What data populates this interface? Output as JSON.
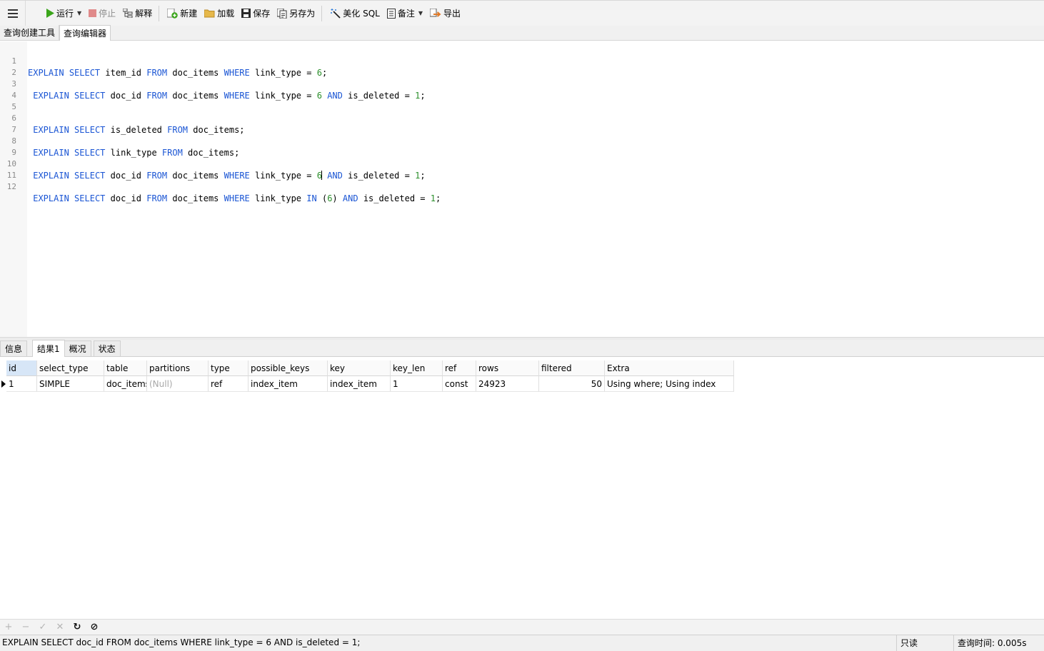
{
  "toolbar": {
    "menu_icon": "hamburger-icon",
    "run": "运行",
    "stop": "停止",
    "explain": "解释",
    "new": "新建",
    "load": "加载",
    "save": "保存",
    "save_as": "另存为",
    "beautify": "美化 SQL",
    "comment": "备注",
    "export": "导出",
    "colors": {
      "run": "#3aa51a",
      "stop": "#e08a8a",
      "new": "#3aa51a",
      "load": "#e6b84a",
      "export": "#e07b2a"
    }
  },
  "editor_tabs": [
    "查询创建工具",
    "查询编辑器"
  ],
  "editor": {
    "lines": [
      {
        "n": "1",
        "code": ""
      },
      {
        "n": "2",
        "code": ""
      },
      {
        "n": "3",
        "code": ""
      },
      {
        "n": "4",
        "code": ""
      },
      {
        "n": "5",
        "code": ""
      },
      {
        "n": "6",
        "code": ""
      },
      {
        "n": "7",
        "code": ""
      },
      {
        "n": "8",
        "code": ""
      },
      {
        "n": "9",
        "code": ""
      },
      {
        "n": "10",
        "code": ""
      },
      {
        "n": "11",
        "code": ""
      },
      {
        "n": "12",
        "code": ""
      }
    ],
    "tokens": {
      "explain": "EXPLAIN",
      "select": "SELECT",
      "from": "FROM",
      "where": "WHERE",
      "and": "AND",
      "in": "IN",
      "item_id": "item_id",
      "doc_id": "doc_id",
      "doc_items": "doc_items",
      "link_type": "link_type",
      "is_deleted": "is_deleted",
      "eq": "=",
      "six": "6",
      "one": "1",
      "semi": ";",
      "lparen": "(",
      "rparen": ")",
      "six_before_caret": "6"
    }
  },
  "result_tabs": [
    "信息",
    "结果1",
    "概况",
    "状态"
  ],
  "grid": {
    "columns": [
      "id",
      "select_type",
      "table",
      "partitions",
      "type",
      "possible_keys",
      "key",
      "key_len",
      "ref",
      "rows",
      "filtered",
      "Extra"
    ],
    "rows": [
      [
        "1",
        "SIMPLE",
        "doc_items",
        "(Null)",
        "ref",
        "index_item",
        "index_item",
        "1",
        "const",
        "24923",
        "50",
        "Using where; Using index"
      ]
    ]
  },
  "actionbar": [
    "plus-icon",
    "minus-icon",
    "check-icon",
    "cross-icon",
    "refresh-icon",
    "stop-circle-icon"
  ],
  "status": {
    "sql": "EXPLAIN SELECT doc_id FROM doc_items WHERE link_type = 6 AND is_deleted = 1;",
    "readonly": "只读",
    "query_time": "查询时间: 0.005s"
  }
}
